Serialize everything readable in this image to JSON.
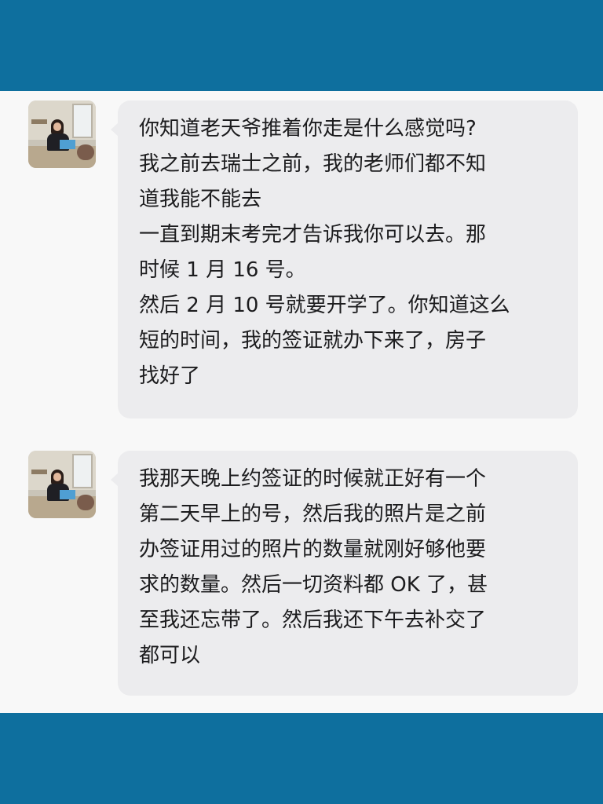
{
  "messages": [
    {
      "lines": [
        "你知道老天爷推着你走是什么感觉吗?",
        "我之前去瑞士之前，我的老师们都不知",
        "道我能不能去",
        "一直到期末考完才告诉我你可以去。那",
        "时候 1 月 16 号。",
        "然后 2 月 10 号就要开学了。你知道这么",
        "短的时间，我的签证就办下来了，房子",
        "找好了"
      ]
    },
    {
      "lines": [
        "我那天晚上约签证的时候就正好有一个",
        "第二天早上的号，然后我的照片是之前",
        "办签证用过的照片的数量就刚好够他要",
        "求的数量。然后一切资料都 OK 了，甚",
        "至我还忘带了。然后我还下午去补交了",
        "都可以"
      ]
    }
  ],
  "colors": {
    "frame": "#0e6f9e",
    "chat_background": "#f8f8f8",
    "bubble": "#ececee",
    "text": "#1c1c1e"
  }
}
